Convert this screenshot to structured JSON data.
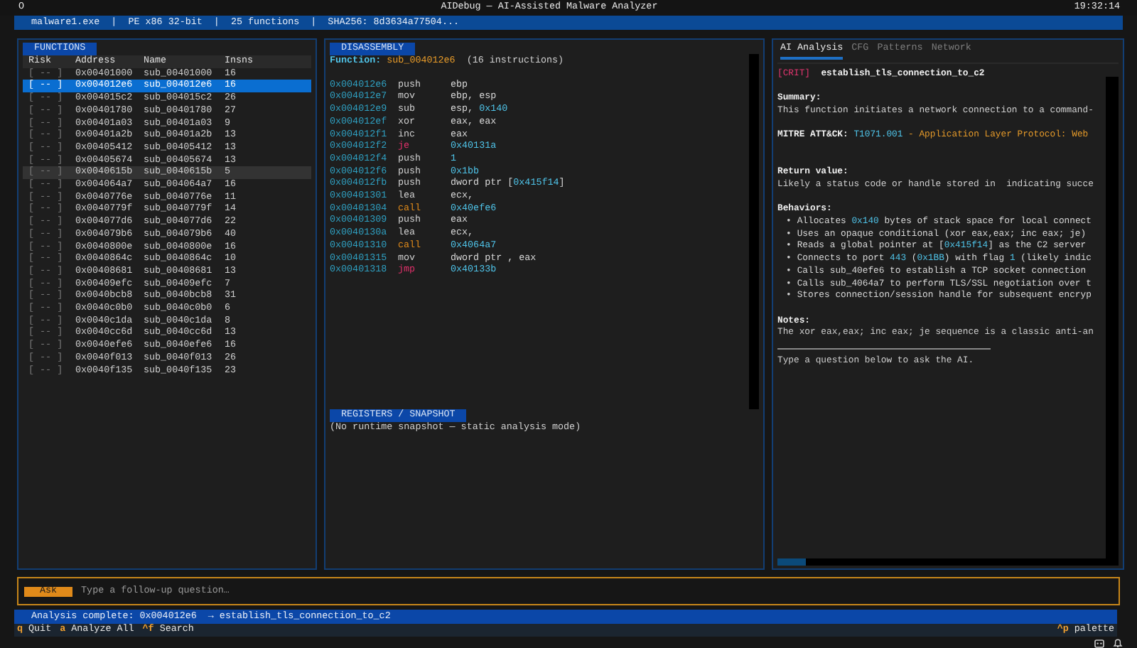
{
  "title_bar": {
    "menu_glyph": "O",
    "title": "AIDebug — AI-Assisted Malware Analyzer",
    "time": "19:32:14"
  },
  "info_bar": {
    "text": "malware1.exe  |  PE x86 32-bit  |  25 functions  |  SHA256: 8d3634a77504..."
  },
  "functions": {
    "title": "FUNCTIONS",
    "columns": [
      "Risk",
      "Address",
      "Name",
      "Insns"
    ],
    "rows": [
      {
        "risk": "[ -- ]",
        "address": "0x00401000",
        "name": "sub_00401000",
        "insns": "16",
        "selected": false,
        "hovered": false
      },
      {
        "risk": "[ -- ]",
        "address": "0x004012e6",
        "name": "sub_004012e6",
        "insns": "16",
        "selected": true,
        "hovered": false
      },
      {
        "risk": "[ -- ]",
        "address": "0x004015c2",
        "name": "sub_004015c2",
        "insns": "26",
        "selected": false,
        "hovered": false
      },
      {
        "risk": "[ -- ]",
        "address": "0x00401780",
        "name": "sub_00401780",
        "insns": "27",
        "selected": false,
        "hovered": false
      },
      {
        "risk": "[ -- ]",
        "address": "0x00401a03",
        "name": "sub_00401a03",
        "insns": "9",
        "selected": false,
        "hovered": false
      },
      {
        "risk": "[ -- ]",
        "address": "0x00401a2b",
        "name": "sub_00401a2b",
        "insns": "13",
        "selected": false,
        "hovered": false
      },
      {
        "risk": "[ -- ]",
        "address": "0x00405412",
        "name": "sub_00405412",
        "insns": "13",
        "selected": false,
        "hovered": false
      },
      {
        "risk": "[ -- ]",
        "address": "0x00405674",
        "name": "sub_00405674",
        "insns": "13",
        "selected": false,
        "hovered": false
      },
      {
        "risk": "[ -- ]",
        "address": "0x0040615b",
        "name": "sub_0040615b",
        "insns": "5",
        "selected": false,
        "hovered": true
      },
      {
        "risk": "[ -- ]",
        "address": "0x004064a7",
        "name": "sub_004064a7",
        "insns": "16",
        "selected": false,
        "hovered": false
      },
      {
        "risk": "[ -- ]",
        "address": "0x0040776e",
        "name": "sub_0040776e",
        "insns": "11",
        "selected": false,
        "hovered": false
      },
      {
        "risk": "[ -- ]",
        "address": "0x0040779f",
        "name": "sub_0040779f",
        "insns": "14",
        "selected": false,
        "hovered": false
      },
      {
        "risk": "[ -- ]",
        "address": "0x004077d6",
        "name": "sub_004077d6",
        "insns": "22",
        "selected": false,
        "hovered": false
      },
      {
        "risk": "[ -- ]",
        "address": "0x004079b6",
        "name": "sub_004079b6",
        "insns": "40",
        "selected": false,
        "hovered": false
      },
      {
        "risk": "[ -- ]",
        "address": "0x0040800e",
        "name": "sub_0040800e",
        "insns": "16",
        "selected": false,
        "hovered": false
      },
      {
        "risk": "[ -- ]",
        "address": "0x0040864c",
        "name": "sub_0040864c",
        "insns": "10",
        "selected": false,
        "hovered": false
      },
      {
        "risk": "[ -- ]",
        "address": "0x00408681",
        "name": "sub_00408681",
        "insns": "13",
        "selected": false,
        "hovered": false
      },
      {
        "risk": "[ -- ]",
        "address": "0x00409efc",
        "name": "sub_00409efc",
        "insns": "7",
        "selected": false,
        "hovered": false
      },
      {
        "risk": "[ -- ]",
        "address": "0x0040bcb8",
        "name": "sub_0040bcb8",
        "insns": "31",
        "selected": false,
        "hovered": false
      },
      {
        "risk": "[ -- ]",
        "address": "0x0040c0b0",
        "name": "sub_0040c0b0",
        "insns": "6",
        "selected": false,
        "hovered": false
      },
      {
        "risk": "[ -- ]",
        "address": "0x0040c1da",
        "name": "sub_0040c1da",
        "insns": "8",
        "selected": false,
        "hovered": false
      },
      {
        "risk": "[ -- ]",
        "address": "0x0040cc6d",
        "name": "sub_0040cc6d",
        "insns": "13",
        "selected": false,
        "hovered": false
      },
      {
        "risk": "[ -- ]",
        "address": "0x0040efe6",
        "name": "sub_0040efe6",
        "insns": "16",
        "selected": false,
        "hovered": false
      },
      {
        "risk": "[ -- ]",
        "address": "0x0040f013",
        "name": "sub_0040f013",
        "insns": "26",
        "selected": false,
        "hovered": false
      },
      {
        "risk": "[ -- ]",
        "address": "0x0040f135",
        "name": "sub_0040f135",
        "insns": "23",
        "selected": false,
        "hovered": false
      }
    ]
  },
  "disassembly": {
    "title": "DISASSEMBLY",
    "function_label": "Function:",
    "function_name": "sub_004012e6",
    "instruction_count": "(16 instructions)",
    "lines": [
      {
        "address": "0x004012e6",
        "mnemonic": "push",
        "kind": "plain",
        "operands": [
          {
            "kind": "reg",
            "text": "ebp"
          }
        ]
      },
      {
        "address": "0x004012e7",
        "mnemonic": "mov",
        "kind": "plain",
        "operands": [
          {
            "kind": "reg",
            "text": "ebp, esp"
          }
        ]
      },
      {
        "address": "0x004012e9",
        "mnemonic": "sub",
        "kind": "plain",
        "operands": [
          {
            "kind": "reg",
            "text": "esp, "
          },
          {
            "kind": "imm",
            "text": "0x140"
          }
        ]
      },
      {
        "address": "0x004012ef",
        "mnemonic": "xor",
        "kind": "plain",
        "operands": [
          {
            "kind": "reg",
            "text": "eax, eax"
          }
        ]
      },
      {
        "address": "0x004012f1",
        "mnemonic": "inc",
        "kind": "plain",
        "operands": [
          {
            "kind": "reg",
            "text": "eax"
          }
        ]
      },
      {
        "address": "0x004012f2",
        "mnemonic": "je",
        "kind": "jump",
        "operands": [
          {
            "kind": "imm",
            "text": "0x40131a"
          }
        ]
      },
      {
        "address": "0x004012f4",
        "mnemonic": "push",
        "kind": "plain",
        "operands": [
          {
            "kind": "imm",
            "text": "1"
          }
        ]
      },
      {
        "address": "0x004012f6",
        "mnemonic": "push",
        "kind": "plain",
        "operands": [
          {
            "kind": "imm",
            "text": "0x1bb"
          }
        ]
      },
      {
        "address": "0x004012fb",
        "mnemonic": "push",
        "kind": "plain",
        "operands": [
          {
            "kind": "reg",
            "text": "dword ptr ["
          },
          {
            "kind": "imm",
            "text": "0x415f14"
          },
          {
            "kind": "reg",
            "text": "]"
          }
        ]
      },
      {
        "address": "0x00401301",
        "mnemonic": "lea",
        "kind": "plain",
        "operands": [
          {
            "kind": "reg",
            "text": "ecx,"
          }
        ]
      },
      {
        "address": "0x00401304",
        "mnemonic": "call",
        "kind": "call",
        "operands": [
          {
            "kind": "imm",
            "text": "0x40efe6"
          }
        ]
      },
      {
        "address": "0x00401309",
        "mnemonic": "push",
        "kind": "plain",
        "operands": [
          {
            "kind": "reg",
            "text": "eax"
          }
        ]
      },
      {
        "address": "0x0040130a",
        "mnemonic": "lea",
        "kind": "plain",
        "operands": [
          {
            "kind": "reg",
            "text": "ecx,"
          }
        ]
      },
      {
        "address": "0x00401310",
        "mnemonic": "call",
        "kind": "call",
        "operands": [
          {
            "kind": "imm",
            "text": "0x4064a7"
          }
        ]
      },
      {
        "address": "0x00401315",
        "mnemonic": "mov",
        "kind": "plain",
        "operands": [
          {
            "kind": "reg",
            "text": "dword ptr , eax"
          }
        ]
      },
      {
        "address": "0x00401318",
        "mnemonic": "jmp",
        "kind": "jump",
        "operands": [
          {
            "kind": "imm",
            "text": "0x40133b"
          }
        ]
      }
    ]
  },
  "registers": {
    "title": "REGISTERS / SNAPSHOT",
    "text": "(No runtime snapshot — static analysis mode)"
  },
  "analysis": {
    "tabs": [
      {
        "label": "AI Analysis",
        "selected": true
      },
      {
        "label": "CFG",
        "selected": false
      },
      {
        "label": "Patterns",
        "selected": false
      },
      {
        "label": "Network",
        "selected": false
      }
    ],
    "severity": "[CRIT]",
    "function_title": "establish_tls_connection_to_c2",
    "summary_label": "Summary:",
    "summary": "This function initiates a network connection to a command-",
    "mitre_label": "MITRE ATT&CK:",
    "mitre_id": "T1071.001",
    "mitre_name": " - Application Layer Protocol: Web",
    "return_label": "Return value:",
    "return_text": "Likely a status code or handle stored in  indicating succe",
    "behaviors_label": "Behaviors:",
    "bullet": "•",
    "behaviors": [
      [
        {
          "kind": "plain",
          "text": "Allocates "
        },
        {
          "kind": "hex",
          "text": "0x140"
        },
        {
          "kind": "plain",
          "text": " bytes of stack space for local connect"
        }
      ],
      [
        {
          "kind": "plain",
          "text": "Uses an opaque conditional (xor eax,eax; inc eax; je)"
        }
      ],
      [
        {
          "kind": "plain",
          "text": "Reads a global pointer at ["
        },
        {
          "kind": "hex",
          "text": "0x415f14"
        },
        {
          "kind": "plain",
          "text": "] as the C2 server"
        }
      ],
      [
        {
          "kind": "plain",
          "text": "Connects to port "
        },
        {
          "kind": "hex",
          "text": "443"
        },
        {
          "kind": "plain",
          "text": " ("
        },
        {
          "kind": "hex",
          "text": "0x1BB"
        },
        {
          "kind": "plain",
          "text": ") with flag "
        },
        {
          "kind": "hex",
          "text": "1"
        },
        {
          "kind": "plain",
          "text": " (likely indic"
        }
      ],
      [
        {
          "kind": "plain",
          "text": "Calls sub_40efe6 to establish a TCP socket connection"
        }
      ],
      [
        {
          "kind": "plain",
          "text": "Calls sub_4064a7 to perform TLS/SSL negotiation over t"
        }
      ],
      [
        {
          "kind": "plain",
          "text": "Stores connection/session handle for subsequent encryp"
        }
      ]
    ],
    "notes_label": "Notes:",
    "notes": "The xor eax,eax; inc eax; je sequence is a classic anti-an",
    "prompt_hint": "Type a question below to ask the AI."
  },
  "ask_bar": {
    "button": "Ask",
    "placeholder": "Type a follow-up question…"
  },
  "status_bar": {
    "text": "Analysis complete: 0x004012e6  → establish_tls_connection_to_c2"
  },
  "footer": {
    "keys": [
      {
        "key": "q",
        "label": "Quit"
      },
      {
        "key": "a",
        "label": "Analyze All"
      },
      {
        "key": "^f",
        "label": "Search"
      }
    ],
    "right_key": {
      "key": "^p",
      "label": "palette"
    }
  }
}
